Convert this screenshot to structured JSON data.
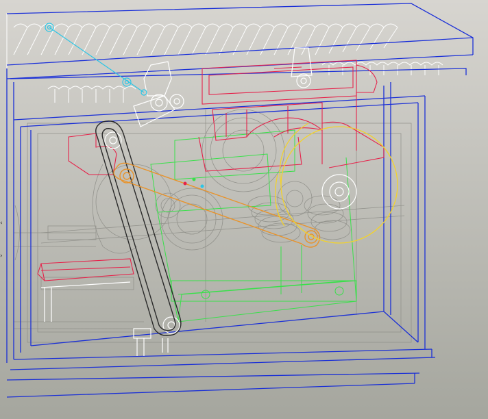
{
  "viewport": {
    "background_top": "#d7d5d0",
    "background_bottom": "#a5a69e"
  },
  "colors": {
    "frame": "#1a2fd6",
    "hidden_edges": "#8c8c86",
    "silhouette": "#ffffff",
    "cover": "#e6224a",
    "base": "#39e04a",
    "link_arm": "#e8932b",
    "flywheel": "#f2d22d",
    "drive_chain": "#2a2a2a",
    "datum_axis": "#2ac6e6"
  },
  "edge_markers": {
    "left_arrow": "‹",
    "right_arrow": "›"
  }
}
